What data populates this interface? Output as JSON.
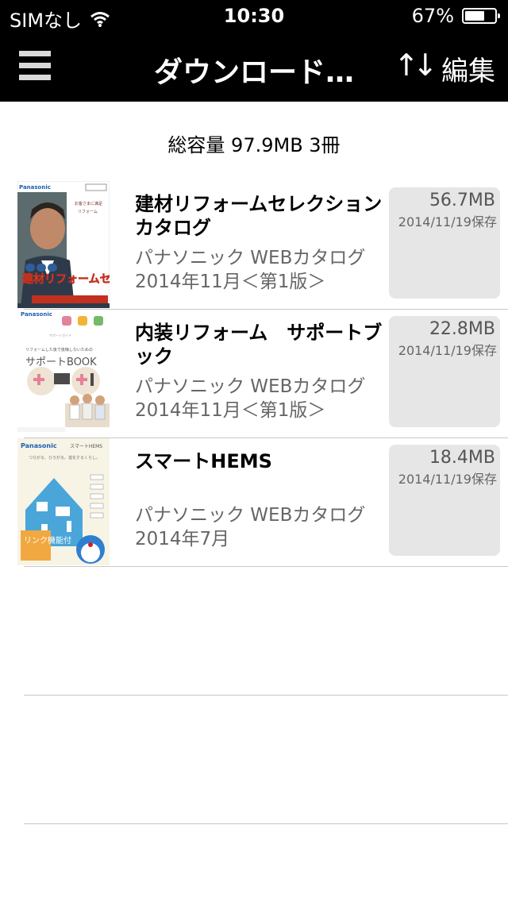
{
  "status_bar": {
    "carrier": "SIMなし",
    "time": "10:30",
    "battery": "67%",
    "battery_level": 0.67
  },
  "nav": {
    "title": "ダウンロード…",
    "sort_icon": "↑↓",
    "edit_label": "編集"
  },
  "summary": "総容量 97.9MB 3冊",
  "items": [
    {
      "title": "建材リフォームセレクションカタログ",
      "publisher": "パナソニック WEBカタログ",
      "edition": "2014年11月＜第1版＞",
      "size": "56.7MB",
      "saved": "2014/11/19保存",
      "thumb": {
        "brand": "Panasonic",
        "label": "建材リフォームセレクション",
        "icon": "catalog-cover-man"
      }
    },
    {
      "title": "内装リフォーム　サポートブック",
      "publisher": "パナソニック WEBカタログ",
      "edition": "2014年11月＜第1版＞",
      "size": "22.8MB",
      "saved": "2014/11/19保存",
      "thumb": {
        "brand": "Panasonic",
        "label": "サポートBOOK",
        "icon": "catalog-cover-family"
      }
    },
    {
      "title": "スマートHEMS",
      "publisher": "パナソニック WEBカタログ",
      "edition": "2014年7月",
      "size": "18.4MB",
      "saved": "2014/11/19保存",
      "thumb": {
        "brand": "Panasonic",
        "title": "スマートHEMS",
        "badge": "リンク機能付",
        "icon": "catalog-cover-house"
      }
    }
  ]
}
